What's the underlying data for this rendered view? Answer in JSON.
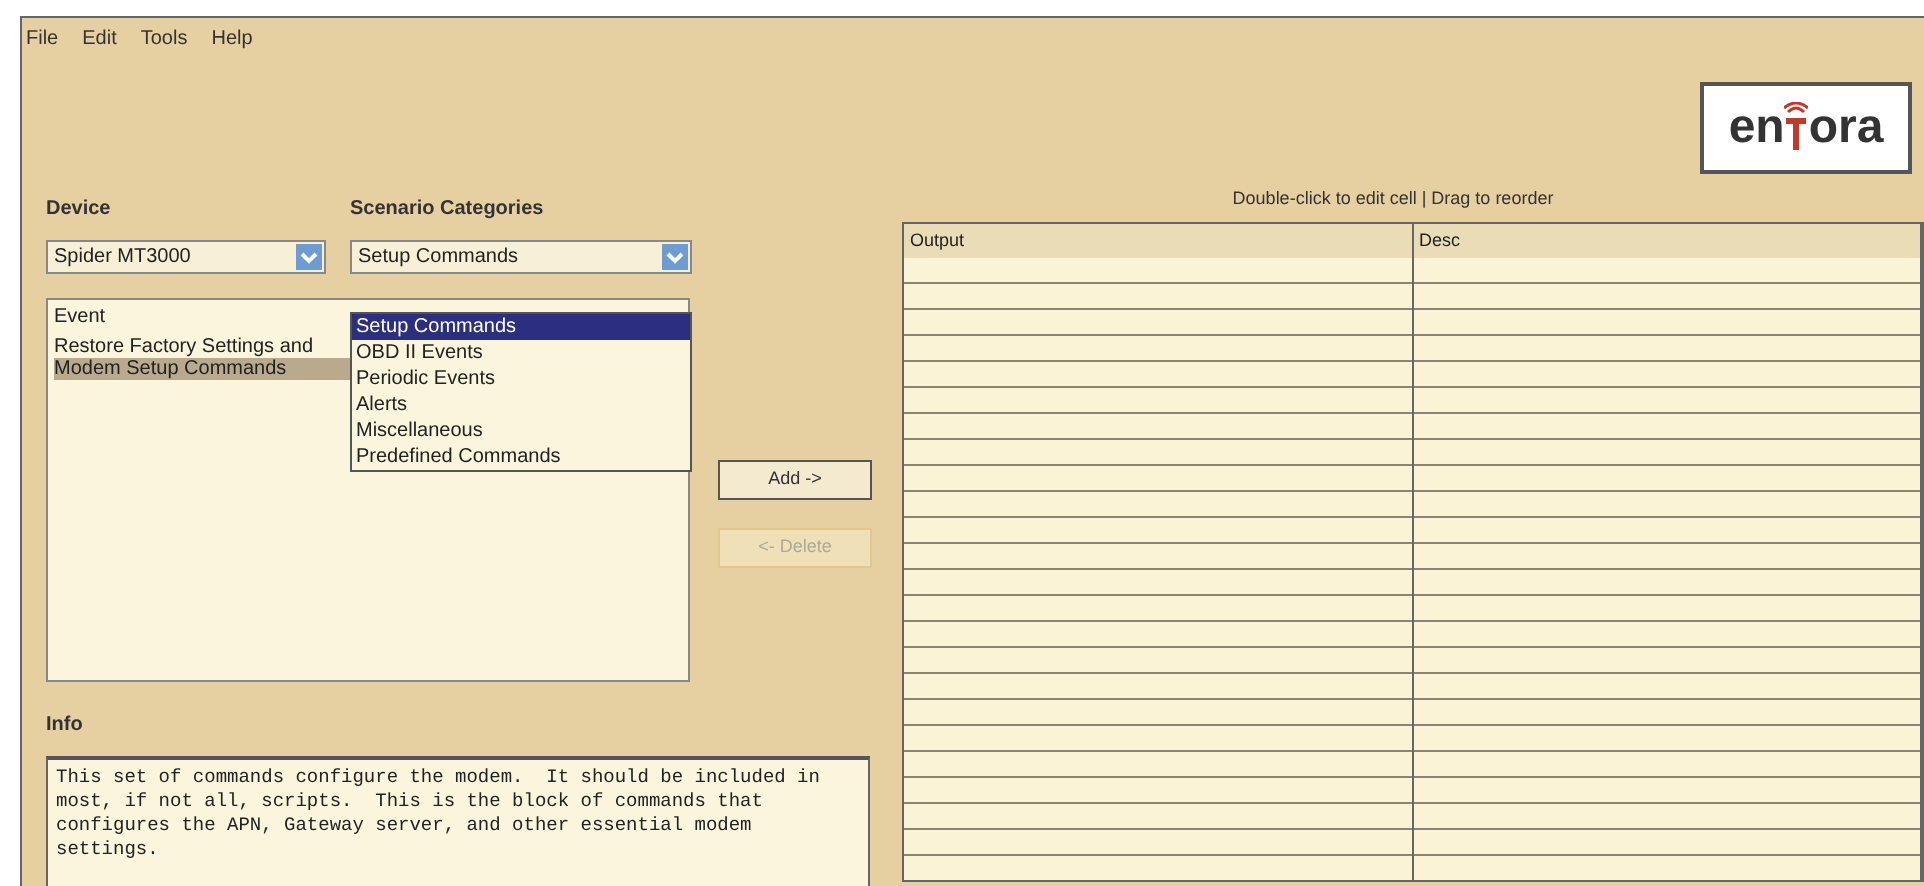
{
  "menu": [
    "File",
    "Edit",
    "Tools",
    "Help"
  ],
  "logo": {
    "left": "en",
    "right": "ora"
  },
  "device": {
    "label": "Device",
    "value": "Spider MT3000"
  },
  "scenario": {
    "label": "Scenario Categories",
    "value": "Setup Commands",
    "expanded": true,
    "options": [
      {
        "label": "Setup Commands",
        "selected": true
      },
      {
        "label": "OBD II Events",
        "selected": false
      },
      {
        "label": "Periodic Events",
        "selected": false
      },
      {
        "label": "Alerts",
        "selected": false
      },
      {
        "label": "Miscellaneous",
        "selected": false
      },
      {
        "label": "Predefined Commands",
        "selected": false
      }
    ]
  },
  "events": {
    "header": "Event",
    "items": [
      {
        "label": "Restore Factory Settings and",
        "selected": false
      },
      {
        "label": "Modem Setup Commands",
        "selected": true
      }
    ]
  },
  "buttons": [
    {
      "label": "Add ->",
      "disabled": false
    },
    {
      "label": "<- Delete",
      "disabled": true
    }
  ],
  "info": {
    "label": "Info",
    "text": "This set of commands configure the modem.  It should be included in most, if not all, scripts.  This is the block of commands that configures the APN, Gateway server, and other essential modem settings."
  },
  "table": {
    "caption": "Double-click to edit cell | Drag to reorder",
    "columns": [
      "Output",
      "Desc"
    ]
  }
}
